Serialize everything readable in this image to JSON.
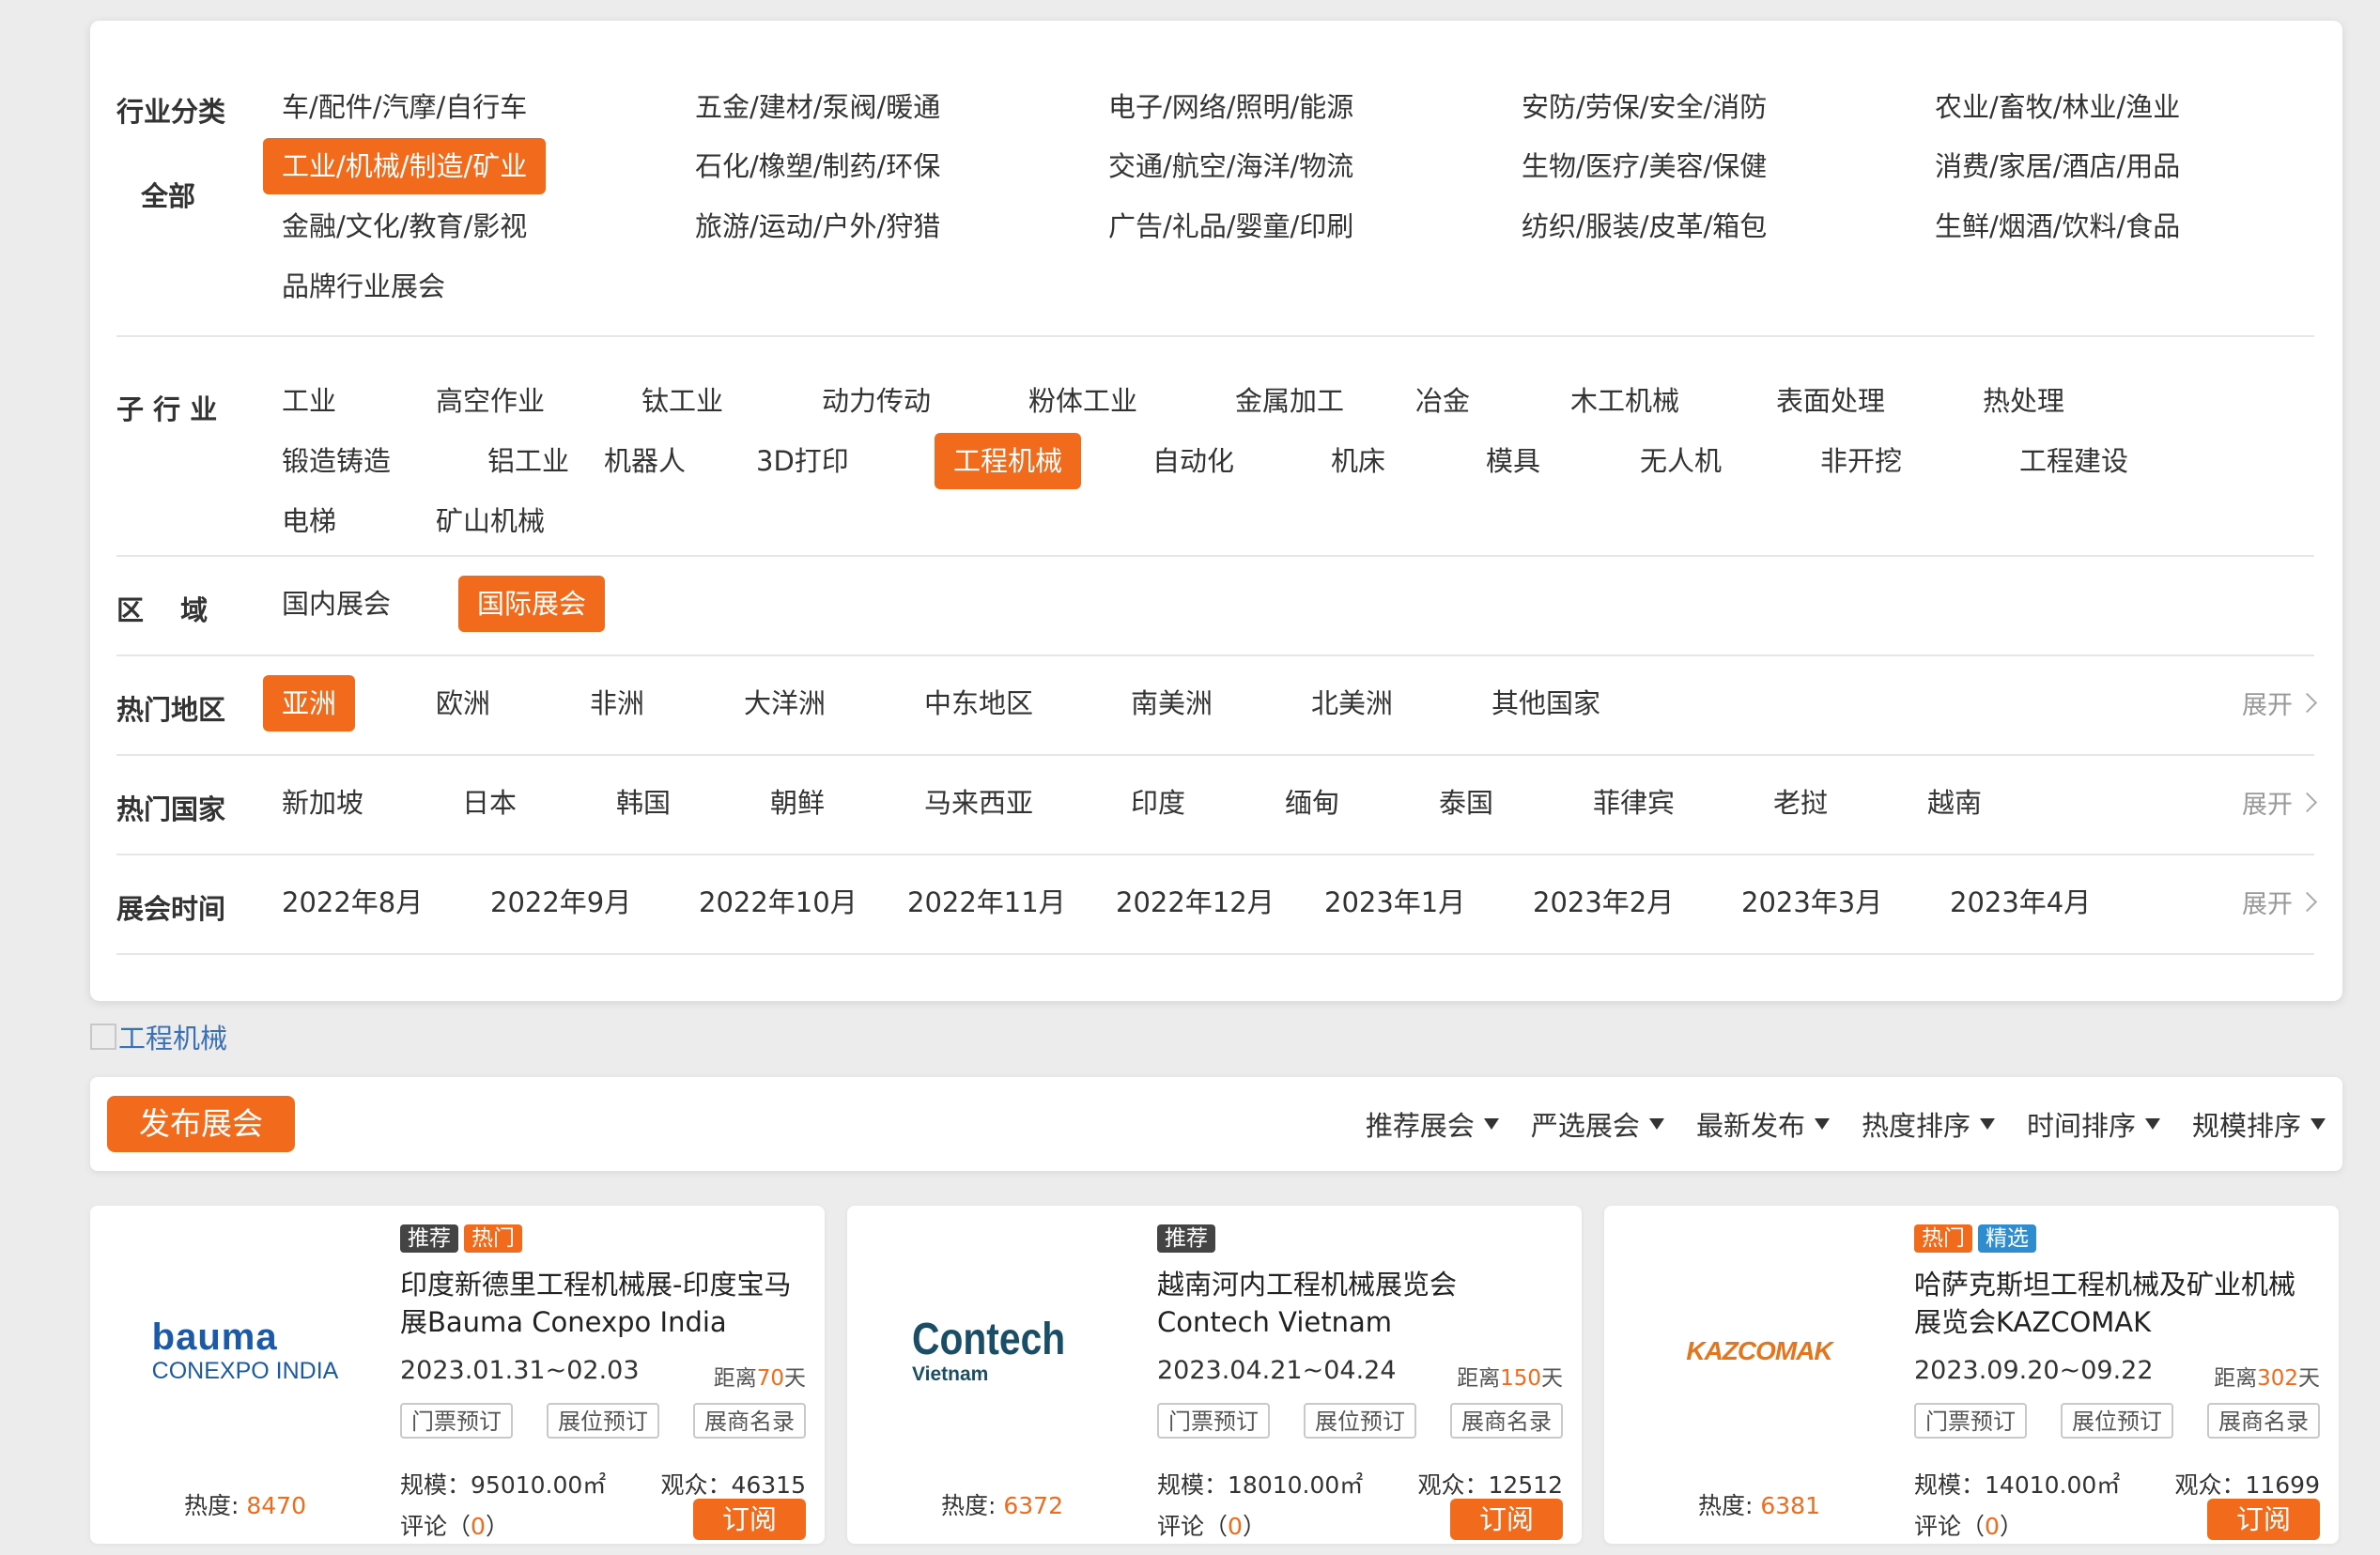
{
  "filters": {
    "industry": {
      "label": "行业分类",
      "all": "全部",
      "items": [
        "车/配件/汽摩/自行车",
        "五金/建材/泵阀/暖通",
        "电子/网络/照明/能源",
        "安防/劳保/安全/消防",
        "农业/畜牧/林业/渔业",
        "工业/机械/制造/矿业",
        "石化/橡塑/制药/环保",
        "交通/航空/海洋/物流",
        "生物/医疗/美容/保健",
        "消费/家居/酒店/用品",
        "金融/文化/教育/影视",
        "旅游/运动/户外/狩猎",
        "广告/礼品/婴童/印刷",
        "纺织/服装/皮革/箱包",
        "生鲜/烟酒/饮料/食品",
        "品牌行业展会"
      ]
    },
    "sub_industry": {
      "label": "子 行 业",
      "items": [
        "工业",
        "高空作业",
        "钛工业",
        "动力传动",
        "粉体工业",
        "金属加工",
        "冶金",
        "木工机械",
        "表面处理",
        "热处理",
        "锻造铸造",
        "铝工业",
        "机器人",
        "3D打印",
        "工程机械",
        "自动化",
        "机床",
        "模具",
        "无人机",
        "非开挖",
        "工程建设",
        "电梯",
        "矿山机械"
      ]
    },
    "region": {
      "label": "区　 域",
      "items": [
        "国内展会",
        "国际展会"
      ]
    },
    "hot_area": {
      "label": "热门地区",
      "items": [
        "亚洲",
        "欧洲",
        "非洲",
        "大洋洲",
        "中东地区",
        "南美洲",
        "北美洲",
        "其他国家"
      ],
      "more": "展开"
    },
    "hot_country": {
      "label": "热门国家",
      "items": [
        "新加坡",
        "日本",
        "韩国",
        "朝鲜",
        "马来西亚",
        "印度",
        "缅甸",
        "泰国",
        "菲律宾",
        "老挝",
        "越南"
      ],
      "more": "展开"
    },
    "time": {
      "label": "展会时间",
      "items": [
        "2022年8月",
        "2022年9月",
        "2022年10月",
        "2022年11月",
        "2022年12月",
        "2023年1月",
        "2023年2月",
        "2023年3月",
        "2023年4月"
      ],
      "more": "展开"
    }
  },
  "breadcrumb": "工程机械",
  "toolbar": {
    "publish": "发布展会",
    "sorts": [
      "推荐展会",
      "严选展会",
      "最新发布",
      "热度排序",
      "时间排序",
      "规模排序"
    ]
  },
  "labels": {
    "heat": "热度:",
    "distance_prefix": "距离",
    "distance_suffix": "天",
    "scale": "规模：",
    "audience": "观众：",
    "comment": "评论",
    "subscribe": "订阅",
    "ticket": "门票预订",
    "booth": "展位预订",
    "exhibitors": "展商名录"
  },
  "cards": [
    {
      "badges": [
        "推荐",
        "热门"
      ],
      "logo": {
        "line1": "bauma",
        "line2": "CONEXPO INDIA"
      },
      "title": "印度新德里工程机械展-印度宝马展Bauma Conexpo India",
      "date": "2023.01.31~02.03",
      "distance": "70",
      "scale": "95010.00㎡",
      "audience": "46315",
      "heat": "8470",
      "comments": "0"
    },
    {
      "badges": [
        "推荐"
      ],
      "logo": {
        "line1": "Contech",
        "line2": "Vietnam"
      },
      "title": "越南河内工程机械展览会Contech Vietnam",
      "date": "2023.04.21~04.24",
      "distance": "150",
      "scale": "18010.00㎡",
      "audience": "12512",
      "heat": "6372",
      "comments": "0"
    },
    {
      "badges": [
        "热门",
        "精选"
      ],
      "logo": {
        "line1": "KAZCOMAK"
      },
      "title": "哈萨克斯坦工程机械及矿业机械展览会KAZCOMAK",
      "date": "2023.09.20~09.22",
      "distance": "302",
      "scale": "14010.00㎡",
      "audience": "11699",
      "heat": "6381",
      "comments": "0"
    }
  ],
  "colors": {
    "accent": "#f26a1b",
    "link": "#3a70b6",
    "badge_dark": "#444444",
    "badge_blue": "#2f8ccf"
  }
}
